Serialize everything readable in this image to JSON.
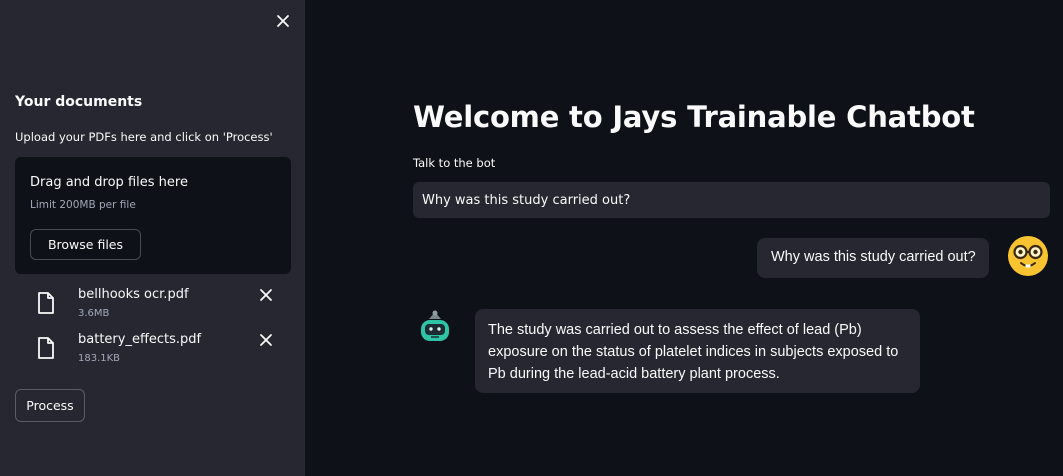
{
  "sidebar": {
    "title": "Your documents",
    "subtitle": "Upload your PDFs here and click on 'Process'",
    "uploader": {
      "drop_text": "Drag and drop files here",
      "limit_text": "Limit 200MB per file",
      "browse_label": "Browse files"
    },
    "files": [
      {
        "name": "bellhooks ocr.pdf",
        "size": "3.6MB"
      },
      {
        "name": "battery_effects.pdf",
        "size": "183.1KB"
      }
    ],
    "process_label": "Process"
  },
  "main": {
    "title": "Welcome to Jays Trainable Chatbot",
    "input_label": "Talk to the bot",
    "input_value": "Why was this study carried out?"
  },
  "chat": {
    "user_message": "Why was this study carried out?",
    "bot_message": "The study was carried out to assess the effect of lead (Pb) exposure on the status of platelet indices in subjects exposed to Pb during the lead-acid battery plant process.",
    "user_avatar_icon": "nerd-face-icon",
    "bot_avatar_icon": "robot-icon"
  },
  "colors": {
    "background": "#0e1117",
    "sidebar": "#262730",
    "bubble": "#262730",
    "text": "#fafafa",
    "muted": "#a3a8b8",
    "avatar_yellow": "#f7c331",
    "bot_teal": "#2ec4a6"
  }
}
